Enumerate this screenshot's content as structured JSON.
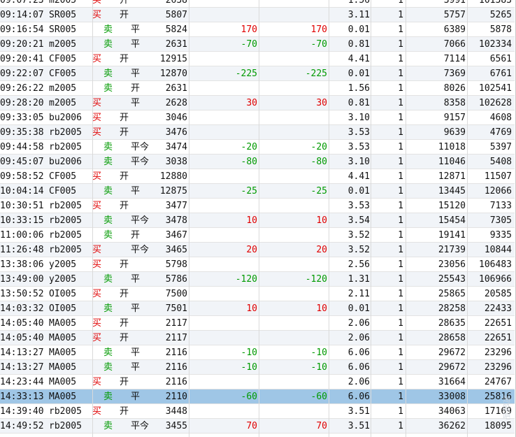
{
  "colors": {
    "buy": "#e00000",
    "sell": "#009a00",
    "selected_row": "#9fc6e6",
    "alt_row": "#f1f4f8"
  },
  "watermark": "淘股吧",
  "selected_index": 27,
  "rows": [
    {
      "time": "09:07:23",
      "symbol": "m2005",
      "dir": "买",
      "offset": "开",
      "price": "2638",
      "pl1": "",
      "pl2": "",
      "fee": "1.56",
      "qty": "1",
      "id1": "3991",
      "id2": "101383"
    },
    {
      "time": "09:14:07",
      "symbol": "SR005",
      "dir": "买",
      "offset": "开",
      "price": "5807",
      "pl1": "",
      "pl2": "",
      "fee": "3.11",
      "qty": "1",
      "id1": "5757",
      "id2": "5265"
    },
    {
      "time": "09:16:54",
      "symbol": "SR005",
      "dir": "卖",
      "offset": "平",
      "price": "5824",
      "pl1": "170",
      "pl2": "170",
      "fee": "0.01",
      "qty": "1",
      "id1": "6389",
      "id2": "5878"
    },
    {
      "time": "09:20:21",
      "symbol": "m2005",
      "dir": "卖",
      "offset": "平",
      "price": "2631",
      "pl1": "-70",
      "pl2": "-70",
      "fee": "0.81",
      "qty": "1",
      "id1": "7066",
      "id2": "102334"
    },
    {
      "time": "09:20:41",
      "symbol": "CF005",
      "dir": "买",
      "offset": "开",
      "price": "12915",
      "pl1": "",
      "pl2": "",
      "fee": "4.41",
      "qty": "1",
      "id1": "7114",
      "id2": "6561"
    },
    {
      "time": "09:22:07",
      "symbol": "CF005",
      "dir": "卖",
      "offset": "平",
      "price": "12870",
      "pl1": "-225",
      "pl2": "-225",
      "fee": "0.01",
      "qty": "1",
      "id1": "7369",
      "id2": "6761"
    },
    {
      "time": "09:26:22",
      "symbol": "m2005",
      "dir": "卖",
      "offset": "开",
      "price": "2631",
      "pl1": "",
      "pl2": "",
      "fee": "1.56",
      "qty": "1",
      "id1": "8026",
      "id2": "102541"
    },
    {
      "time": "09:28:20",
      "symbol": "m2005",
      "dir": "买",
      "offset": "平",
      "price": "2628",
      "pl1": "30",
      "pl2": "30",
      "fee": "0.81",
      "qty": "1",
      "id1": "8358",
      "id2": "102628"
    },
    {
      "time": "09:33:05",
      "symbol": "bu2006",
      "dir": "买",
      "offset": "开",
      "price": "3046",
      "pl1": "",
      "pl2": "",
      "fee": "3.10",
      "qty": "1",
      "id1": "9157",
      "id2": "4608"
    },
    {
      "time": "09:35:38",
      "symbol": "rb2005",
      "dir": "买",
      "offset": "开",
      "price": "3476",
      "pl1": "",
      "pl2": "",
      "fee": "3.53",
      "qty": "1",
      "id1": "9639",
      "id2": "4769"
    },
    {
      "time": "09:44:58",
      "symbol": "rb2005",
      "dir": "卖",
      "offset": "平今",
      "price": "3474",
      "pl1": "-20",
      "pl2": "-20",
      "fee": "3.53",
      "qty": "1",
      "id1": "11018",
      "id2": "5397"
    },
    {
      "time": "09:45:07",
      "symbol": "bu2006",
      "dir": "卖",
      "offset": "平今",
      "price": "3038",
      "pl1": "-80",
      "pl2": "-80",
      "fee": "3.10",
      "qty": "1",
      "id1": "11046",
      "id2": "5408"
    },
    {
      "time": "09:58:52",
      "symbol": "CF005",
      "dir": "买",
      "offset": "开",
      "price": "12880",
      "pl1": "",
      "pl2": "",
      "fee": "4.41",
      "qty": "1",
      "id1": "12871",
      "id2": "11507"
    },
    {
      "time": "10:04:14",
      "symbol": "CF005",
      "dir": "卖",
      "offset": "平",
      "price": "12875",
      "pl1": "-25",
      "pl2": "-25",
      "fee": "0.01",
      "qty": "1",
      "id1": "13445",
      "id2": "12066"
    },
    {
      "time": "10:30:51",
      "symbol": "rb2005",
      "dir": "买",
      "offset": "开",
      "price": "3477",
      "pl1": "",
      "pl2": "",
      "fee": "3.53",
      "qty": "1",
      "id1": "15120",
      "id2": "7133"
    },
    {
      "time": "10:33:15",
      "symbol": "rb2005",
      "dir": "卖",
      "offset": "平今",
      "price": "3478",
      "pl1": "10",
      "pl2": "10",
      "fee": "3.54",
      "qty": "1",
      "id1": "15454",
      "id2": "7305"
    },
    {
      "time": "11:00:06",
      "symbol": "rb2005",
      "dir": "卖",
      "offset": "开",
      "price": "3467",
      "pl1": "",
      "pl2": "",
      "fee": "3.52",
      "qty": "1",
      "id1": "19141",
      "id2": "9335"
    },
    {
      "time": "11:26:48",
      "symbol": "rb2005",
      "dir": "买",
      "offset": "平今",
      "price": "3465",
      "pl1": "20",
      "pl2": "20",
      "fee": "3.52",
      "qty": "1",
      "id1": "21739",
      "id2": "10844"
    },
    {
      "time": "13:38:06",
      "symbol": "y2005",
      "dir": "买",
      "offset": "开",
      "price": "5798",
      "pl1": "",
      "pl2": "",
      "fee": "2.56",
      "qty": "1",
      "id1": "23056",
      "id2": "106483"
    },
    {
      "time": "13:49:00",
      "symbol": "y2005",
      "dir": "卖",
      "offset": "平",
      "price": "5786",
      "pl1": "-120",
      "pl2": "-120",
      "fee": "1.31",
      "qty": "1",
      "id1": "25543",
      "id2": "106966"
    },
    {
      "time": "13:50:52",
      "symbol": "OI005",
      "dir": "买",
      "offset": "开",
      "price": "7500",
      "pl1": "",
      "pl2": "",
      "fee": "2.11",
      "qty": "1",
      "id1": "25865",
      "id2": "20585"
    },
    {
      "time": "14:03:32",
      "symbol": "OI005",
      "dir": "卖",
      "offset": "平",
      "price": "7501",
      "pl1": "10",
      "pl2": "10",
      "fee": "0.01",
      "qty": "1",
      "id1": "28258",
      "id2": "22433"
    },
    {
      "time": "14:05:40",
      "symbol": "MA005",
      "dir": "买",
      "offset": "开",
      "price": "2117",
      "pl1": "",
      "pl2": "",
      "fee": "2.06",
      "qty": "1",
      "id1": "28635",
      "id2": "22651"
    },
    {
      "time": "14:05:40",
      "symbol": "MA005",
      "dir": "买",
      "offset": "开",
      "price": "2117",
      "pl1": "",
      "pl2": "",
      "fee": "2.06",
      "qty": "1",
      "id1": "28658",
      "id2": "22651"
    },
    {
      "time": "14:13:27",
      "symbol": "MA005",
      "dir": "卖",
      "offset": "平",
      "price": "2116",
      "pl1": "-10",
      "pl2": "-10",
      "fee": "6.06",
      "qty": "1",
      "id1": "29672",
      "id2": "23296"
    },
    {
      "time": "14:13:27",
      "symbol": "MA005",
      "dir": "卖",
      "offset": "平",
      "price": "2116",
      "pl1": "-10",
      "pl2": "-10",
      "fee": "6.06",
      "qty": "1",
      "id1": "29672",
      "id2": "23296"
    },
    {
      "time": "14:23:44",
      "symbol": "MA005",
      "dir": "买",
      "offset": "开",
      "price": "2116",
      "pl1": "",
      "pl2": "",
      "fee": "2.06",
      "qty": "1",
      "id1": "31664",
      "id2": "24767"
    },
    {
      "time": "14:33:13",
      "symbol": "MA005",
      "dir": "卖",
      "offset": "平",
      "price": "2110",
      "pl1": "-60",
      "pl2": "-60",
      "fee": "6.06",
      "qty": "1",
      "id1": "33008",
      "id2": "25816"
    },
    {
      "time": "14:39:40",
      "symbol": "rb2005",
      "dir": "买",
      "offset": "开",
      "price": "3448",
      "pl1": "",
      "pl2": "",
      "fee": "3.51",
      "qty": "1",
      "id1": "34063",
      "id2": "17169"
    },
    {
      "time": "14:49:52",
      "symbol": "rb2005",
      "dir": "卖",
      "offset": "平今",
      "price": "3455",
      "pl1": "70",
      "pl2": "70",
      "fee": "3.51",
      "qty": "1",
      "id1": "36262",
      "id2": "18095"
    }
  ]
}
